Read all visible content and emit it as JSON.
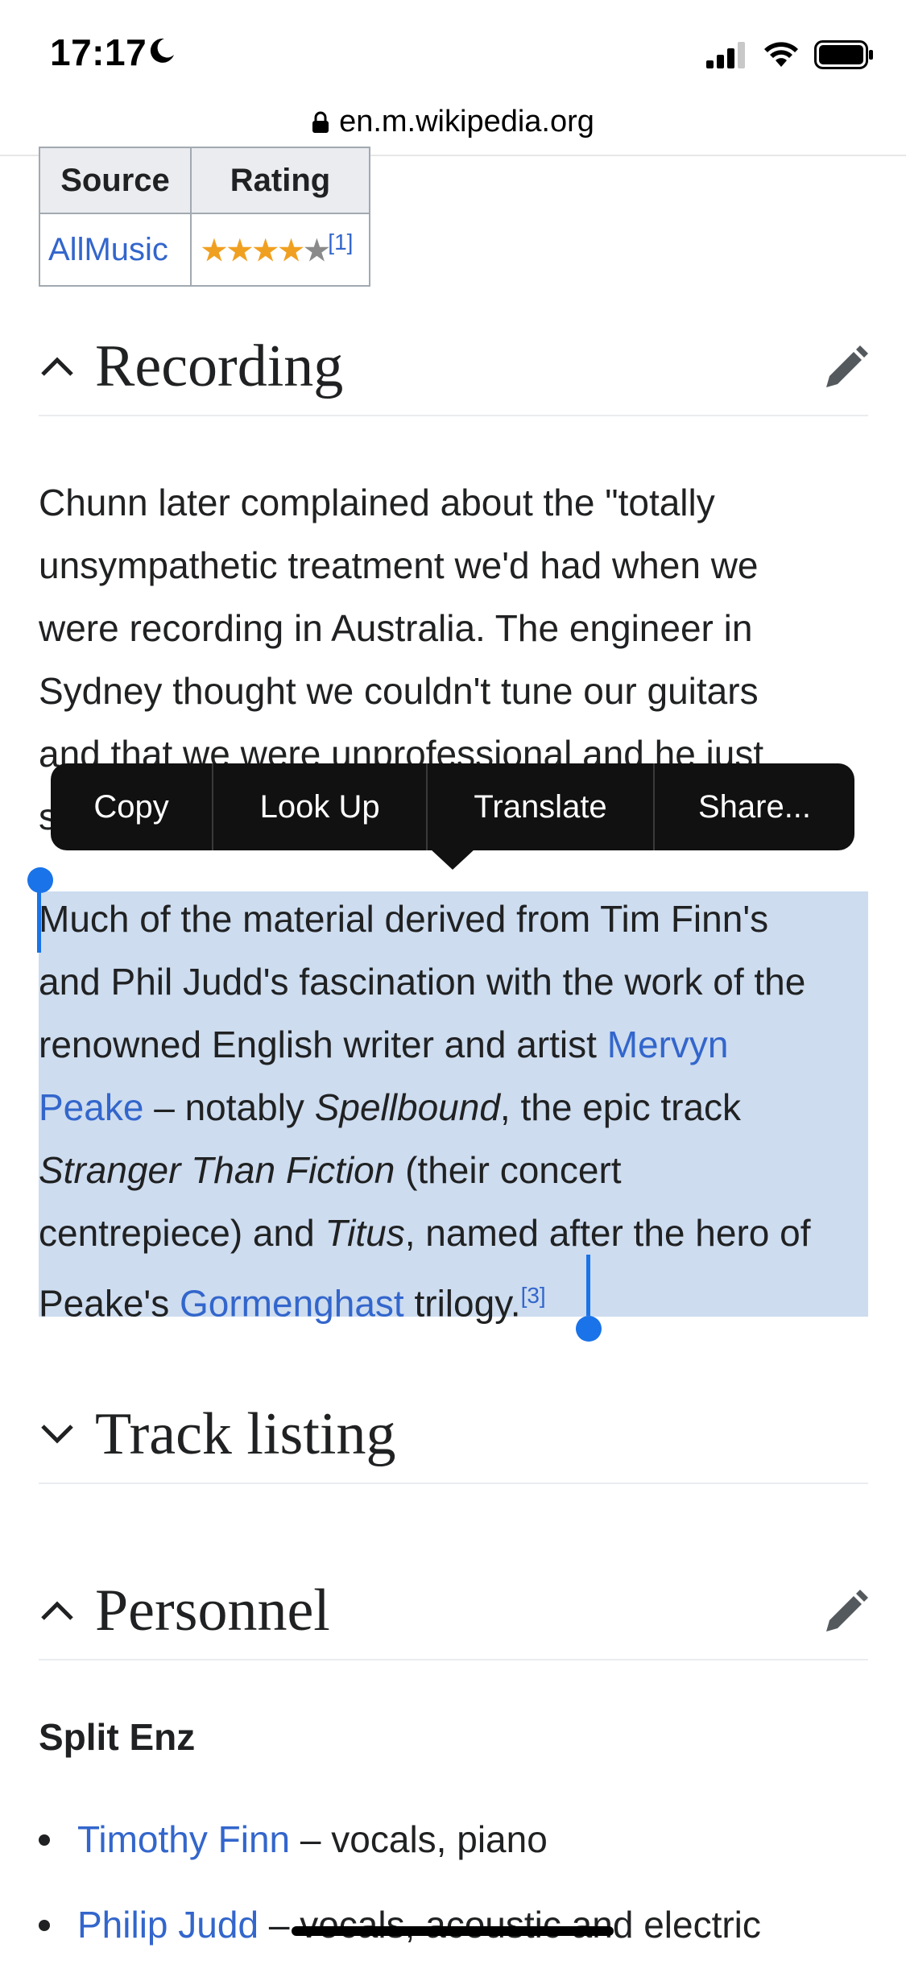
{
  "status_bar": {
    "time": "17:17"
  },
  "url_bar": {
    "domain": "en.m.wikipedia.org"
  },
  "ratings_table": {
    "headers": [
      "Source",
      "Rating"
    ],
    "rows": [
      {
        "source": "AllMusic",
        "stars": 4.5,
        "ref": "[1]"
      }
    ]
  },
  "sections": {
    "recording": {
      "title": "Recording",
      "collapsed": false
    },
    "track_listing": {
      "title": "Track listing",
      "collapsed": true
    },
    "personnel": {
      "title": "Personnel",
      "collapsed": false
    }
  },
  "recording_text": {
    "p1_lines": [
      "Chunn later complained about the \"totally",
      "unsympathetic treatment we'd had when we",
      "were recording in Australia. The engineer in",
      "Sydney thought we couldn't tune our guitars",
      "and that we were unprofessional and he just",
      "s"
    ],
    "p2": {
      "line1": "Much of the material derived from Tim Finn's",
      "line2": "and Phil Judd's fascination with the work of the",
      "line3_pre": "renowned English writer and artist ",
      "link_mervyn": "Mervyn",
      "link_peake": "Peake",
      "line4_mid": " – notably ",
      "spellbound": "Spellbound",
      "line4_post": ", the epic track",
      "stranger": "Stranger Than Fiction",
      "line5_post": " (their concert",
      "line6_pre": "centrepiece) and ",
      "titus": "Titus",
      "line6_post": ", named after the hero of",
      "line7_pre": "Peake's ",
      "link_gormenghast": "Gormenghast",
      "line7_post": " trilogy.",
      "ref": "[3]"
    }
  },
  "context_menu": {
    "items": [
      "Copy",
      "Look Up",
      "Translate",
      "Share..."
    ]
  },
  "personnel": {
    "subheading": "Split Enz",
    "members": [
      {
        "name": "Timothy Finn",
        "role": " – vocals, piano"
      },
      {
        "name": "Philip Judd",
        "role": " – vocals, acoustic and electric"
      }
    ]
  },
  "colors": {
    "link": "#3366cc",
    "selection": "#cddcef",
    "handle": "#1a73e8",
    "menu_bg": "#111111"
  }
}
